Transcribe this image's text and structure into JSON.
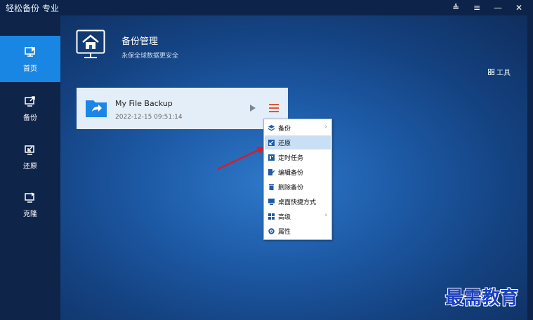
{
  "app": {
    "title": "轻松备份 专业",
    "controls": {
      "pin": "≜",
      "menu": "≡",
      "minimize": "—",
      "close": "✕"
    }
  },
  "sidebar": {
    "items": [
      {
        "label": "首页",
        "icon": "home-monitor-icon",
        "active": true
      },
      {
        "label": "备份",
        "icon": "backup-icon",
        "active": false
      },
      {
        "label": "还原",
        "icon": "restore-icon",
        "active": false
      },
      {
        "label": "克隆",
        "icon": "clone-icon",
        "active": false
      }
    ]
  },
  "header": {
    "title": "备份管理",
    "subtitle": "永保全球数据更安全",
    "tools_label": "工具",
    "icon": "home-icon"
  },
  "backup_card": {
    "name": "My File Backup",
    "date": "2022-12-15 09:51:14",
    "icon": "folder-icon"
  },
  "context_menu": {
    "items": [
      {
        "label": "备份",
        "icon": "layers-icon",
        "submenu": true,
        "highlighted": false
      },
      {
        "label": "还原",
        "icon": "restore-icon",
        "submenu": false,
        "highlighted": true
      },
      {
        "label": "定时任务",
        "icon": "schedule-icon",
        "submenu": false,
        "highlighted": false
      },
      {
        "label": "编辑备份",
        "icon": "edit-icon",
        "submenu": false,
        "highlighted": false
      },
      {
        "label": "删除备份",
        "icon": "trash-icon",
        "submenu": false,
        "highlighted": false
      },
      {
        "label": "桌面快捷方式",
        "icon": "shortcut-icon",
        "submenu": false,
        "highlighted": false
      },
      {
        "label": "高级",
        "icon": "grid-icon",
        "submenu": true,
        "highlighted": false
      },
      {
        "label": "属性",
        "icon": "gear-icon",
        "submenu": false,
        "highlighted": false
      }
    ]
  },
  "watermark": "最需教育",
  "colors": {
    "accent": "#1a86e3",
    "sidebar_bg": "#0e2448",
    "card_bg": "#e4eef9",
    "menu_button": "#e8532f",
    "highlight": "#c9dff6",
    "arrow": "#d0202a"
  }
}
